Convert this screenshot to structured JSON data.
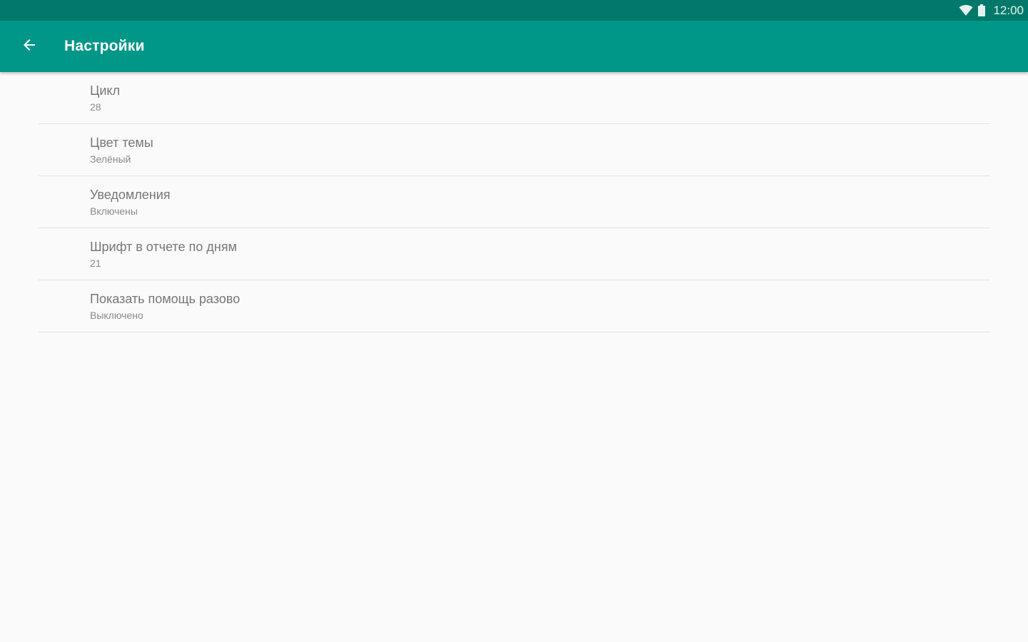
{
  "status_bar": {
    "time": "12:00",
    "icons": [
      "wifi-icon",
      "battery-icon"
    ],
    "color": "#00796b"
  },
  "app_bar": {
    "title": "Настройки",
    "back_icon": "arrow-back-icon",
    "color": "#009688"
  },
  "settings": {
    "items": [
      {
        "title": "Цикл",
        "summary": "28"
      },
      {
        "title": "Цвет темы",
        "summary": "Зелёный"
      },
      {
        "title": "Уведомления",
        "summary": "Включены"
      },
      {
        "title": "Шрифт в отчете по дням",
        "summary": "21"
      },
      {
        "title": "Показать помощь разово",
        "summary": "Выключено"
      }
    ]
  }
}
